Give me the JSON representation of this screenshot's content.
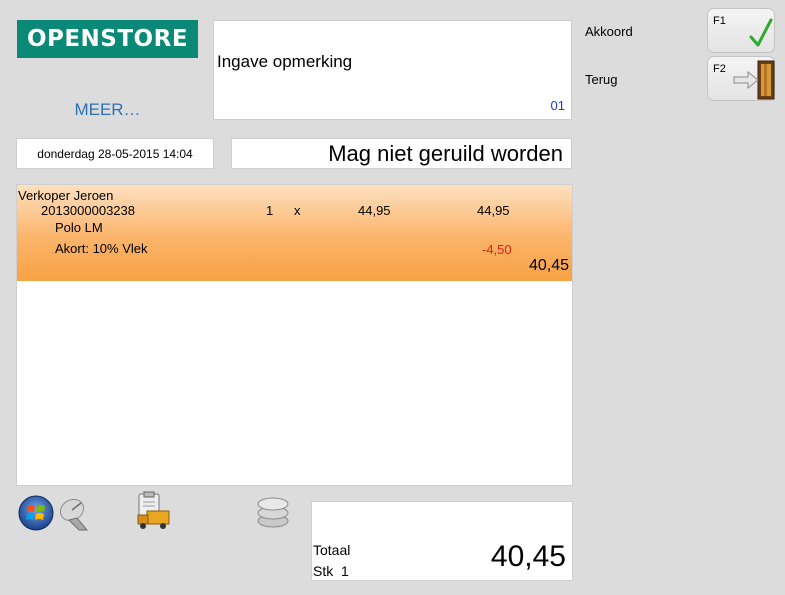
{
  "header": {
    "logo_text": "OPENSTORE",
    "more_label": "MEER…"
  },
  "remark": {
    "title": "Ingave opmerking",
    "code": "01"
  },
  "status": {
    "datetime": "donderdag 28-05-2015 14:04",
    "message": "Mag niet geruild worden"
  },
  "item": {
    "seller": "Verkoper Jeroen",
    "barcode": "2013000003238",
    "quantity": "1",
    "times": "x",
    "unit_price": "44,95",
    "line_price": "44,95",
    "name": "Polo LM",
    "discount_label": "Akort: 10% Vlek",
    "discount_amount": "-4,50",
    "net_price": "40,45"
  },
  "totals": {
    "total_label": "Totaal",
    "stk_label": "Stk",
    "stk_count": "1",
    "total_value": "40,45"
  },
  "commands": [
    {
      "label": "Akkoord",
      "key": "F1",
      "icon": "checkmark-icon"
    },
    {
      "label": "Terug",
      "key": "F2",
      "icon": "exit-door-icon"
    }
  ],
  "toolbar_icons": [
    "windows-start-icon",
    "satellite-dish-icon",
    "delivery-truck-icon",
    "coin-stack-icon"
  ],
  "colors": {
    "logo": "#0a8a76",
    "row_highlight": "#f7a244",
    "discount": "#e02020",
    "code": "#1a3dcc",
    "more_link": "#2f6fb3"
  }
}
